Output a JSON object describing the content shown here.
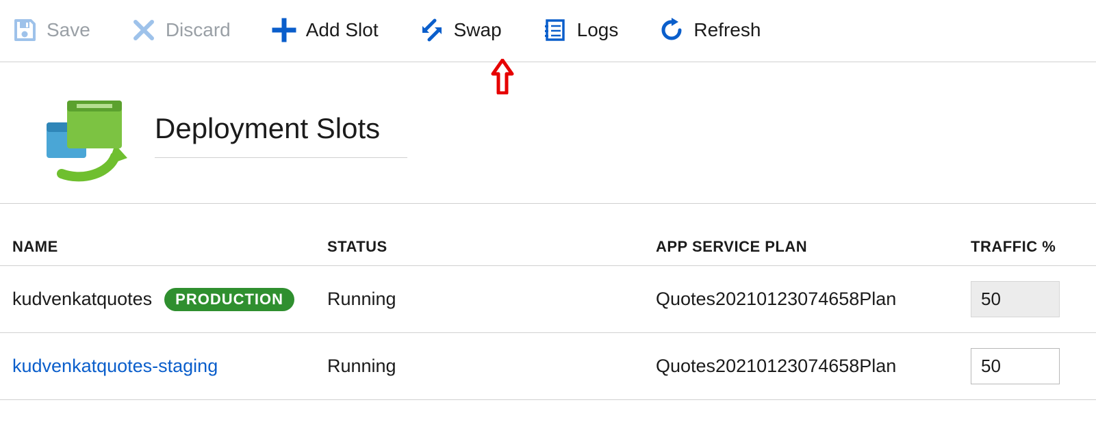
{
  "toolbar": {
    "save": {
      "label": "Save",
      "enabled": false
    },
    "discard": {
      "label": "Discard",
      "enabled": false
    },
    "addslot": {
      "label": "Add Slot",
      "enabled": true
    },
    "swap": {
      "label": "Swap",
      "enabled": true
    },
    "logs": {
      "label": "Logs",
      "enabled": true
    },
    "refresh": {
      "label": "Refresh",
      "enabled": true
    }
  },
  "page": {
    "title": "Deployment Slots"
  },
  "table": {
    "headers": {
      "name": "NAME",
      "status": "STATUS",
      "plan": "APP SERVICE PLAN",
      "traffic": "TRAFFIC %"
    },
    "rows": [
      {
        "name": "kudvenkatquotes",
        "badge": "PRODUCTION",
        "is_production": true,
        "status": "Running",
        "plan": "Quotes20210123074658Plan",
        "traffic": "50"
      },
      {
        "name": "kudvenkatquotes-staging",
        "badge": "",
        "is_production": false,
        "status": "Running",
        "plan": "Quotes20210123074658Plan",
        "traffic": "50"
      }
    ]
  },
  "colors": {
    "accent": "#0a5ecb",
    "disabled": "#9aa0a6",
    "badge_bg": "#2f8f2f",
    "annotation": "#e60000"
  }
}
